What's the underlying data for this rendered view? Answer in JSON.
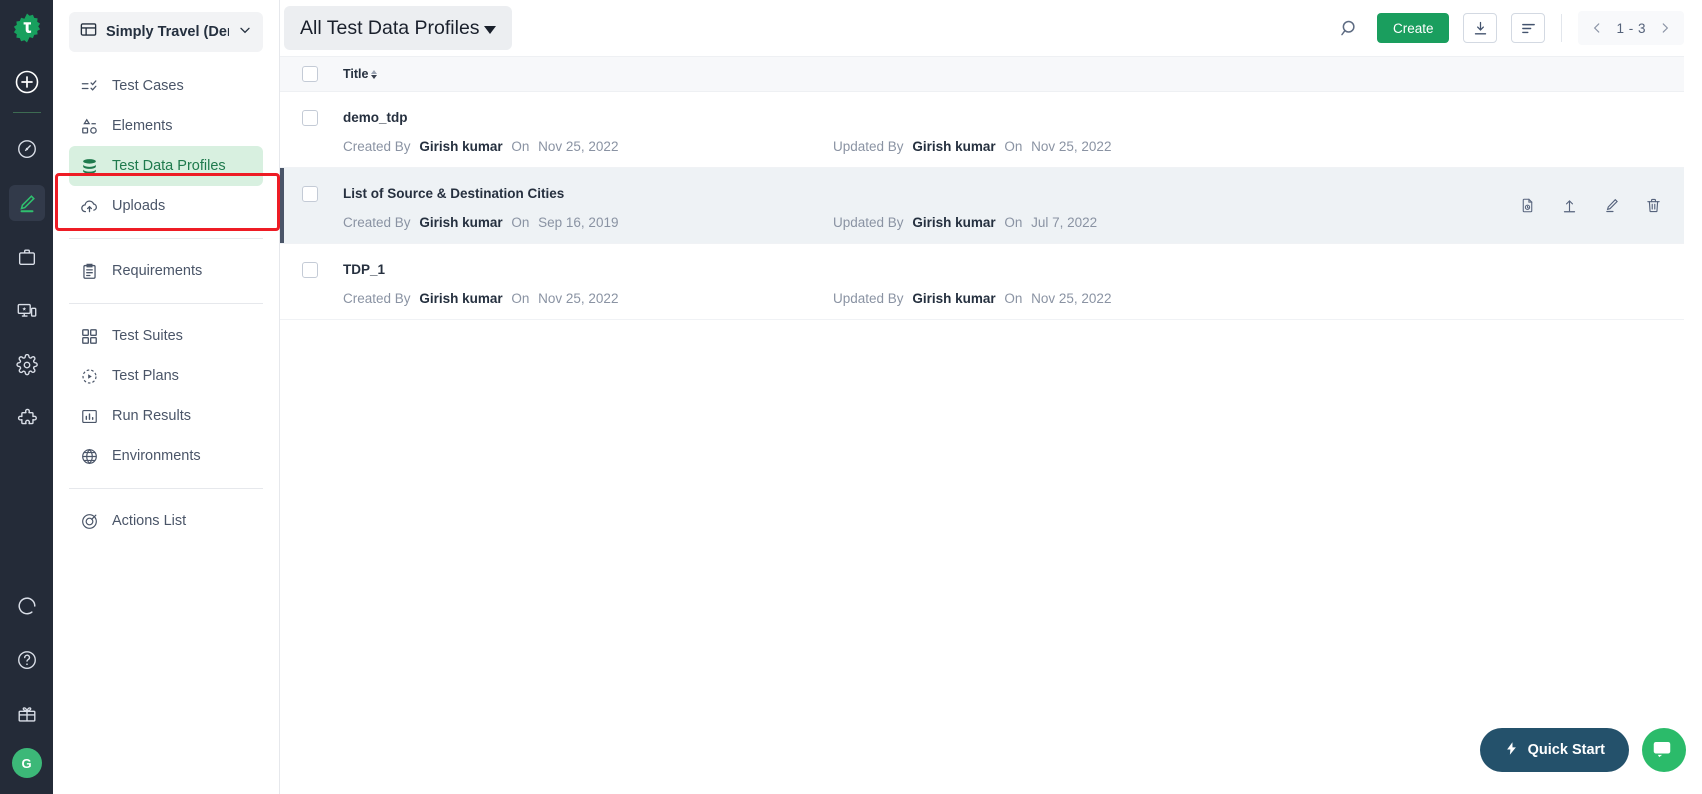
{
  "rail": {
    "logo_icon": "testsigma-gear-logo-icon",
    "add_icon": "plus-circle-icon",
    "avatar_initial": "G",
    "items": [
      {
        "icon": "speedometer-icon",
        "name": "rail-item-dashboard",
        "active": false
      },
      {
        "icon": "pencil-underline-icon",
        "name": "rail-item-create",
        "active": true
      },
      {
        "icon": "briefcase-icon",
        "name": "rail-item-projects",
        "active": false
      },
      {
        "icon": "devices-icon",
        "name": "rail-item-devices",
        "active": false
      },
      {
        "icon": "gear-icon",
        "name": "rail-item-settings",
        "active": false
      },
      {
        "icon": "puzzle-icon",
        "name": "rail-item-addons",
        "active": false
      }
    ],
    "bottom_items": [
      {
        "icon": "loading-ring-icon",
        "name": "rail-item-activity"
      },
      {
        "icon": "question-circle-icon",
        "name": "rail-item-help"
      },
      {
        "icon": "gift-icon",
        "name": "rail-item-whats-new"
      }
    ]
  },
  "sidebar": {
    "project": {
      "label": "Simply Travel (Demo)",
      "icon": "project-card-icon",
      "chevron": "chevron-down-icon"
    },
    "groups": [
      {
        "items": [
          {
            "label": "Test Cases",
            "icon": "test-cases-icon",
            "selected": false
          },
          {
            "label": "Elements",
            "icon": "elements-icon",
            "selected": false
          },
          {
            "label": "Test Data Profiles",
            "icon": "database-stack-icon",
            "selected": true
          },
          {
            "label": "Uploads",
            "icon": "cloud-upload-icon",
            "selected": false
          }
        ]
      },
      {
        "items": [
          {
            "label": "Requirements",
            "icon": "clipboard-icon",
            "selected": false
          }
        ]
      },
      {
        "items": [
          {
            "label": "Test Suites",
            "icon": "grid-squares-icon",
            "selected": false
          },
          {
            "label": "Test Plans",
            "icon": "play-circle-icon",
            "selected": false
          },
          {
            "label": "Run Results",
            "icon": "bar-chart-icon",
            "selected": false
          },
          {
            "label": "Environments",
            "icon": "globe-icon",
            "selected": false
          }
        ]
      },
      {
        "items": [
          {
            "label": "Actions List",
            "icon": "target-icon",
            "selected": false
          }
        ]
      }
    ]
  },
  "topbar": {
    "title": "All Test Data Profiles",
    "caret_icon": "caret-down-icon",
    "search_icon": "search-icon",
    "create_label": "Create",
    "download_icon": "download-icon",
    "sort_icon": "sort-lines-icon",
    "prev_icon": "chevron-left-icon",
    "next_icon": "chevron-right-icon",
    "pagination": "1 - 3"
  },
  "table": {
    "header": {
      "select_all": "select-all-checkbox",
      "title_column": "Title",
      "sort_glyph": "sort-asc-desc-icon"
    },
    "labels": {
      "created_by": "Created By",
      "updated_by": "Updated By",
      "on": "On"
    },
    "rows": [
      {
        "title": "demo_tdp",
        "created_by": "Girish kumar",
        "created_on": "Nov 25, 2022",
        "updated_by": "Girish kumar",
        "updated_on": "Nov 25, 2022",
        "hovered": false
      },
      {
        "title": "List of Source & Destination Cities",
        "created_by": "Girish kumar",
        "created_on": "Sep 16, 2019",
        "updated_by": "Girish kumar",
        "updated_on": "Jul 7, 2022",
        "hovered": true
      },
      {
        "title": "TDP_1",
        "created_by": "Girish kumar",
        "created_on": "Nov 25, 2022",
        "updated_by": "Girish kumar",
        "updated_on": "Nov 25, 2022",
        "hovered": false
      }
    ],
    "row_actions": [
      {
        "icon": "document-history-icon",
        "name": "row-action-history"
      },
      {
        "icon": "upload-icon",
        "name": "row-action-upload"
      },
      {
        "icon": "pencil-edit-icon",
        "name": "row-action-edit"
      },
      {
        "icon": "trash-delete-icon",
        "name": "row-action-delete"
      }
    ]
  },
  "floating": {
    "quick_start_label": "Quick Start",
    "quick_start_icon": "lightning-bolt-icon",
    "chat_icon": "chat-bubble-icon"
  },
  "colors": {
    "brand_green": "#1a9e5e",
    "rail_bg": "#242b38",
    "selected_nav_bg": "#d8f0e0",
    "selected_nav_text": "#1f7a4d",
    "highlight_red": "#ee1c25",
    "quick_start_bg": "#24516b",
    "chat_bg": "#2bbb6a"
  }
}
